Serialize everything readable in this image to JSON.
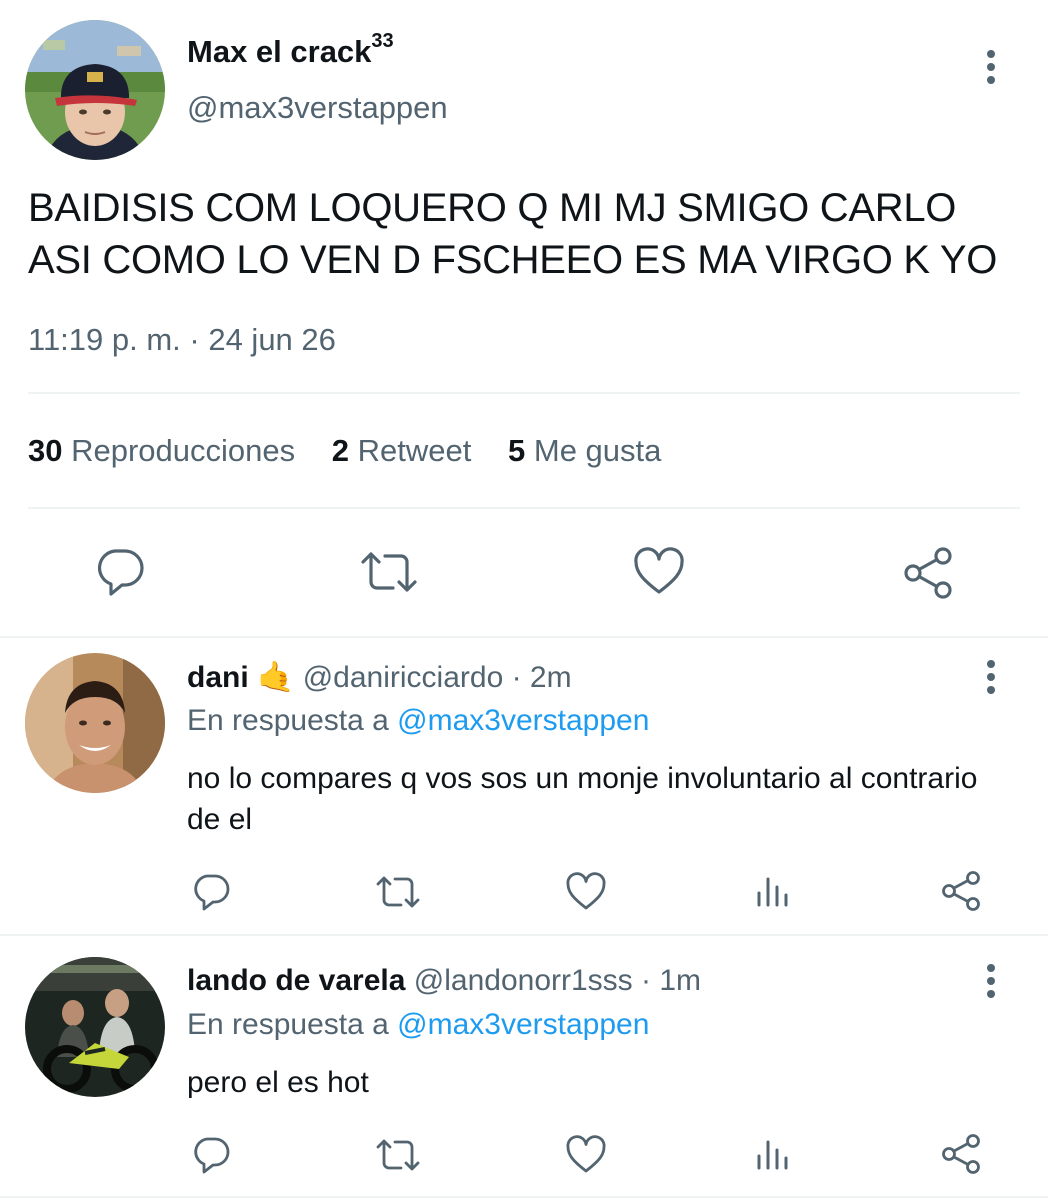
{
  "main_tweet": {
    "author_name": "Max el crack",
    "author_name_sup": "33",
    "author_handle": "@max3verstappen",
    "text_line1": "BAIDISIS COM LOQUERO Q MI MJ SMIGO CARLO",
    "text_line2": "ASI COMO LO VEN D FSCHEEO ES MA VIRGO K YO",
    "timestamp": "11:19 p. m. · 24 jun 26",
    "stats": {
      "views_count": "30",
      "views_label": "Reproducciones",
      "retweets_count": "2",
      "retweets_label": "Retweet",
      "likes_count": "5",
      "likes_label": "Me gusta"
    }
  },
  "replies": [
    {
      "author_name": "dani",
      "author_emoji": "🤙",
      "author_handle": "@daniricciardo",
      "time": "· 2m",
      "reply_prefix": "En respuesta a",
      "reply_to": "@max3verstappen",
      "text": "no lo compares q vos sos un monje involuntario al contrario de el"
    },
    {
      "author_name": "lando de varela",
      "author_handle": "@landonorr1sss",
      "time": "· 1m",
      "reply_prefix": "En respuesta a",
      "reply_to": "@max3verstappen",
      "text": "pero el es hot"
    }
  ],
  "icons": {
    "reply": "speech-bubble-icon",
    "retweet": "retweet-arrows-icon",
    "like": "heart-icon",
    "share": "share-icon",
    "analytics": "bar-chart-icon",
    "more": "vertical-dots-icon"
  },
  "colors": {
    "text": "#0f1419",
    "muted": "#536471",
    "link": "#1d9bf0",
    "divider": "#eff3f4"
  }
}
